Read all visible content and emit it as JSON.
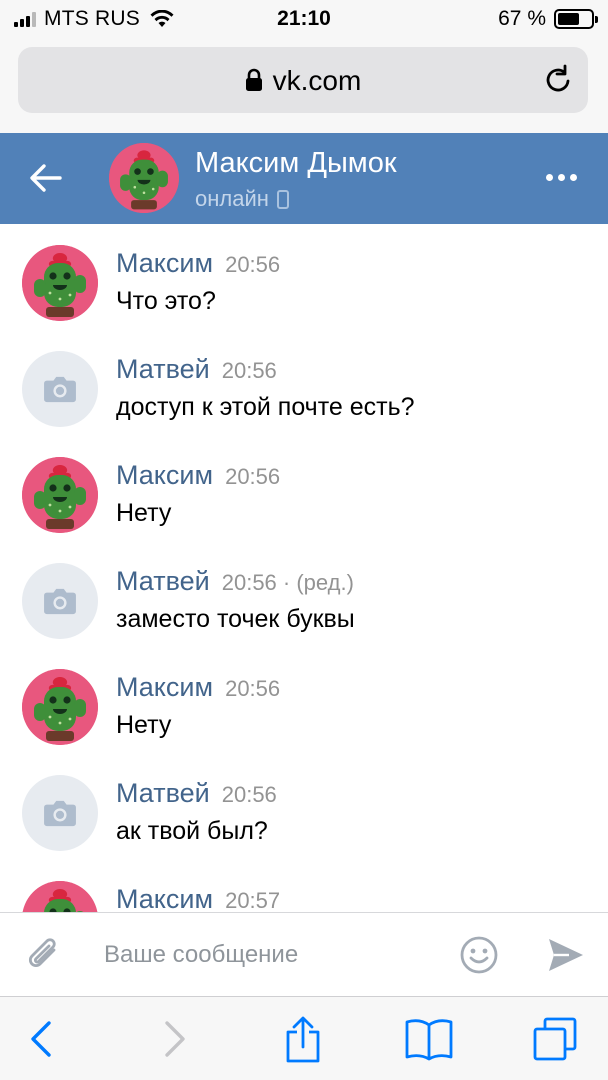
{
  "status_bar": {
    "carrier": "MTS RUS",
    "time": "21:10",
    "battery_percent": "67 %",
    "battery_level": 0.67,
    "signal_bars_filled": 3,
    "signal_bars_total": 4
  },
  "browser": {
    "url": "vk.com",
    "icons": {
      "lock": "lock-icon",
      "reload": "reload-icon"
    }
  },
  "chat_header": {
    "name": "Максим Дымок",
    "status": "онлайн",
    "icons": {
      "back": "back-arrow-icon",
      "more": "more-icon",
      "device": "mobile-phone-icon"
    }
  },
  "messages": [
    {
      "author": "Максим",
      "time": "20:56",
      "text": "Что это?",
      "avatar": "cactus-avatar"
    },
    {
      "author": "Матвей",
      "time": "20:56",
      "text": "доступ к этой почте есть?",
      "avatar": "camera-placeholder-avatar"
    },
    {
      "author": "Максим",
      "time": "20:56",
      "text": "Нету",
      "avatar": "cactus-avatar"
    },
    {
      "author": "Матвей",
      "time": "20:56 · (ред.)",
      "text": "заместо точек буквы",
      "avatar": "camera-placeholder-avatar"
    },
    {
      "author": "Максим",
      "time": "20:56",
      "text": "Нету",
      "avatar": "cactus-avatar"
    },
    {
      "author": "Матвей",
      "time": "20:56",
      "text": "ак твой был?",
      "avatar": "camera-placeholder-avatar"
    },
    {
      "author": "Максим",
      "time": "20:57",
      "text": "",
      "avatar": "cactus-avatar"
    }
  ],
  "composer": {
    "placeholder": "Ваше сообщение",
    "value": "",
    "icons": {
      "attach": "paperclip-icon",
      "emoji": "emoji-icon",
      "send": "send-icon"
    }
  },
  "toolbar": {
    "icons": [
      "back-icon",
      "forward-icon",
      "share-icon",
      "bookmarks-icon",
      "tabs-icon"
    ]
  },
  "colors": {
    "vk_header": "#5181b8",
    "author_name": "#42648b",
    "ios_blue": "#007aff",
    "timestamp": "#939393"
  }
}
